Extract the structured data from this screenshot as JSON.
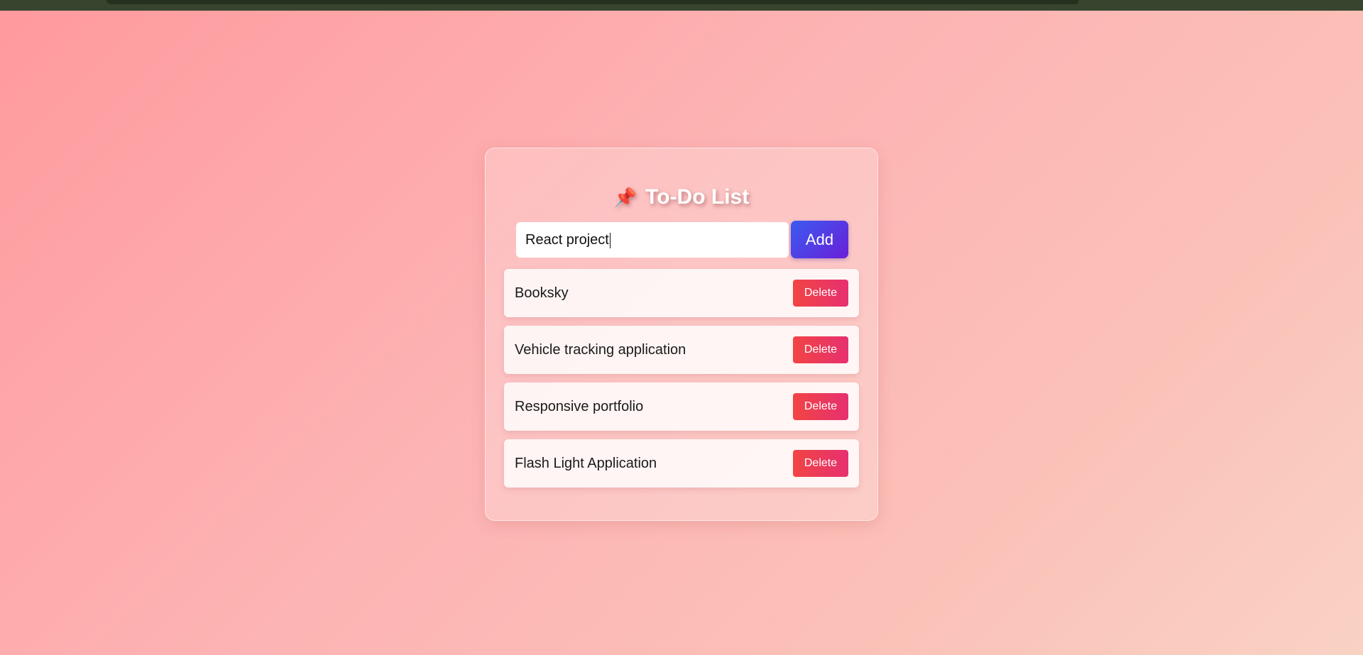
{
  "app": {
    "title": "To-Do List",
    "title_icon": "pushpin-icon",
    "title_icon_glyph": "📌"
  },
  "input": {
    "value": "React project",
    "placeholder": ""
  },
  "add_button": {
    "label": "Add",
    "gradient": [
      "#3b5bf0",
      "#6a1fd8"
    ]
  },
  "tasks": [
    {
      "label": "Booksky",
      "delete_label": "Delete"
    },
    {
      "label": "Vehicle tracking application",
      "delete_label": "Delete"
    },
    {
      "label": "Responsive portfolio",
      "delete_label": "Delete"
    },
    {
      "label": "Flash Light Application",
      "delete_label": "Delete"
    }
  ],
  "colors": {
    "background_gradient": [
      "#ff9a9e",
      "#f9d2c4"
    ],
    "delete_gradient": [
      "#f24444",
      "#e63070"
    ],
    "top_strip": "#37452f"
  }
}
